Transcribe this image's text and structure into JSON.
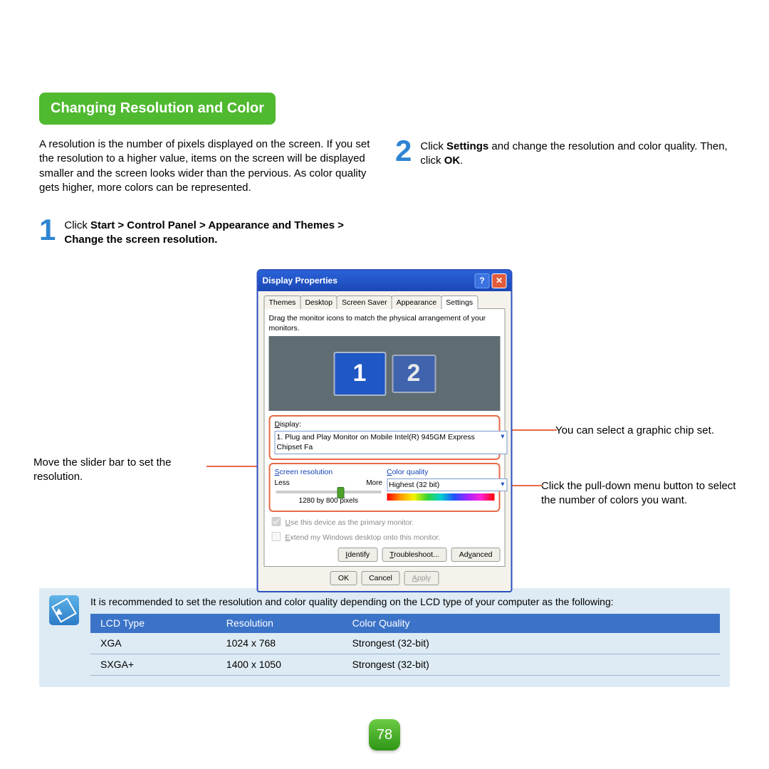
{
  "section_title": "Changing Resolution and Color",
  "intro": "A resolution is the number of pixels displayed on the screen. If you set the resolution to a higher value, items on the screen will be displayed smaller and the screen looks wider than the pervious. As color quality gets higher, more colors can be represented.",
  "step1": {
    "num": "1",
    "pre": "Click ",
    "bold": "Start > Control Panel > Appearance and Themes > Change the screen resolution."
  },
  "step2": {
    "num": "2",
    "parts": [
      "Click ",
      "Settings",
      " and change the resolution and color quality. Then, click ",
      "OK",
      "."
    ]
  },
  "dialog": {
    "title": "Display Properties",
    "tabs": [
      "Themes",
      "Desktop",
      "Screen Saver",
      "Appearance",
      "Settings"
    ],
    "active_tab": 4,
    "drag_hint": "Drag the monitor icons to match the physical arrangement of your monitors.",
    "mon1": "1",
    "mon2": "2",
    "display_label": "Display:",
    "display_value": "1. Plug and Play Monitor on Mobile Intel(R) 945GM Express Chipset Fa",
    "sr_label": "Screen resolution",
    "sr_less": "Less",
    "sr_more": "More",
    "sr_value": "1280 by 800 pixels",
    "cq_label": "Color quality",
    "cq_value": "Highest (32 bit)",
    "chk1": "Use this device as the primary monitor.",
    "chk2": "Extend my Windows desktop onto this monitor.",
    "btns_mid": [
      "Identify",
      "Troubleshoot...",
      "Advanced"
    ],
    "btns_bot": [
      "OK",
      "Cancel",
      "Apply"
    ]
  },
  "callouts": {
    "left": "Move the slider bar to set the resolution.",
    "right1": "You can select a graphic chip set.",
    "right2": "Click the pull-down menu button to select the number of colors you want."
  },
  "note": {
    "intro": "It is recommended to set the resolution and color quality depending on the LCD type of your computer as the following:",
    "headers": [
      "LCD Type",
      "Resolution",
      "Color Quality"
    ],
    "rows": [
      [
        "XGA",
        "1024 x 768",
        "Strongest (32-bit)"
      ],
      [
        "SXGA+",
        "1400 x 1050",
        "Strongest (32-bit)"
      ]
    ]
  },
  "page_number": "78"
}
